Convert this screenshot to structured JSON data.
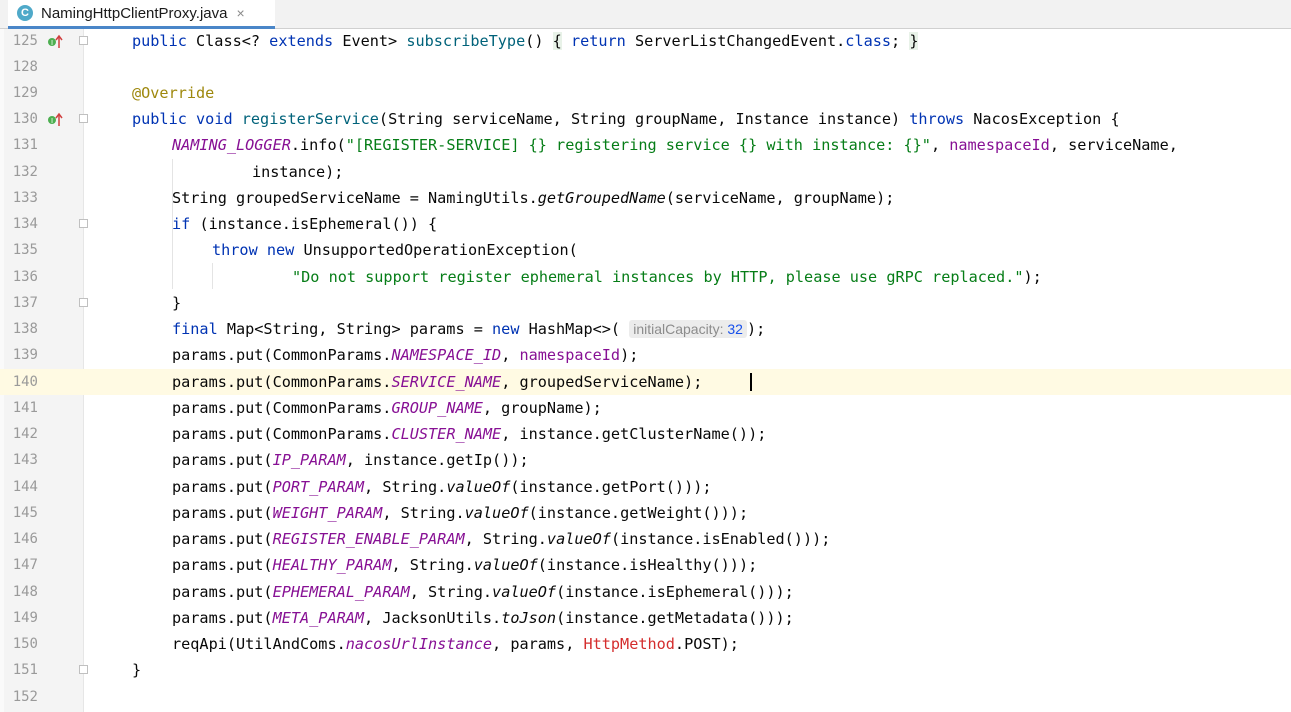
{
  "tab": {
    "icon": "C",
    "filename": "NamingHttpClientProxy.java",
    "close": "×"
  },
  "hint": {
    "label": "initialCapacity:",
    "value": "32"
  },
  "lines": [
    {
      "num": "125",
      "text": "public Class<? extends Event> subscribeType() { return ServerListChangedEvent.class; }"
    },
    {
      "num": "128",
      "text": ""
    },
    {
      "num": "129",
      "text": "@Override"
    },
    {
      "num": "130",
      "text": "public void registerService(String serviceName, String groupName, Instance instance) throws NacosException {"
    },
    {
      "num": "131",
      "text": "NAMING_LOGGER.info(\"[REGISTER-SERVICE] {} registering service {} with instance: {}\", namespaceId, serviceName,"
    },
    {
      "num": "132",
      "text": "instance);"
    },
    {
      "num": "133",
      "text": "String groupedServiceName = NamingUtils.getGroupedName(serviceName, groupName);"
    },
    {
      "num": "134",
      "text": "if (instance.isEphemeral()) {"
    },
    {
      "num": "135",
      "text": "throw new UnsupportedOperationException("
    },
    {
      "num": "136",
      "text": "\"Do not support register ephemeral instances by HTTP, please use gRPC replaced.\");"
    },
    {
      "num": "137",
      "text": "}"
    },
    {
      "num": "138",
      "text": "final Map<String, String> params = new HashMap<>( initialCapacity: 32);"
    },
    {
      "num": "139",
      "text": "params.put(CommonParams.NAMESPACE_ID, namespaceId);"
    },
    {
      "num": "140",
      "text": "params.put(CommonParams.SERVICE_NAME, groupedServiceName);"
    },
    {
      "num": "141",
      "text": "params.put(CommonParams.GROUP_NAME, groupName);"
    },
    {
      "num": "142",
      "text": "params.put(CommonParams.CLUSTER_NAME, instance.getClusterName());"
    },
    {
      "num": "143",
      "text": "params.put(IP_PARAM, instance.getIp());"
    },
    {
      "num": "144",
      "text": "params.put(PORT_PARAM, String.valueOf(instance.getPort()));"
    },
    {
      "num": "145",
      "text": "params.put(WEIGHT_PARAM, String.valueOf(instance.getWeight()));"
    },
    {
      "num": "146",
      "text": "params.put(REGISTER_ENABLE_PARAM, String.valueOf(instance.isEnabled()));"
    },
    {
      "num": "147",
      "text": "params.put(HEALTHY_PARAM, String.valueOf(instance.isHealthy()));"
    },
    {
      "num": "148",
      "text": "params.put(EPHEMERAL_PARAM, String.valueOf(instance.isEphemeral()));"
    },
    {
      "num": "149",
      "text": "params.put(META_PARAM, JacksonUtils.toJson(instance.getMetadata()));"
    },
    {
      "num": "150",
      "text": "reqApi(UtilAndComs.nacosUrlInstance, params, HttpMethod.POST);"
    },
    {
      "num": "151",
      "text": "}"
    },
    {
      "num": "152",
      "text": ""
    }
  ],
  "colors": {
    "keyword": "#0033b3",
    "string": "#067d17",
    "field": "#871094",
    "annotation": "#9e880d",
    "current_line": "#fffae3"
  }
}
